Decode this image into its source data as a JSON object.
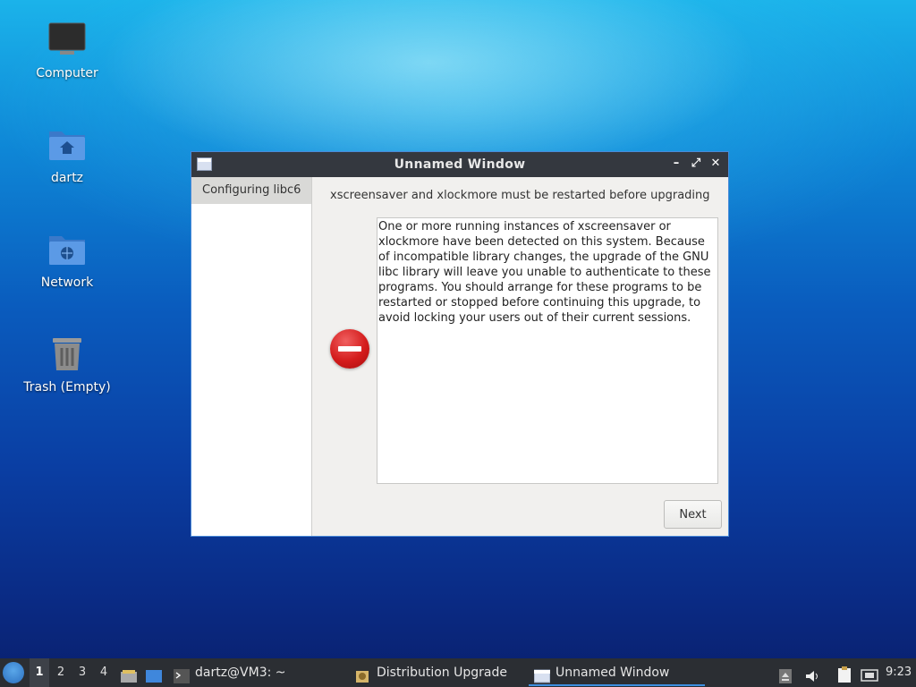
{
  "desktop": {
    "icons": [
      {
        "label": "Computer",
        "icon": "monitor-icon"
      },
      {
        "label": "dartz",
        "icon": "home-folder-icon"
      },
      {
        "label": "Network",
        "icon": "network-folder-icon"
      },
      {
        "label": "Trash (Empty)",
        "icon": "trash-icon"
      }
    ]
  },
  "window": {
    "title": "Unnamed Window",
    "controls": {
      "minimize": "–",
      "maximize": "⤢",
      "close": "✕"
    },
    "sidebar": {
      "steps": [
        "Configuring libc6"
      ]
    },
    "heading": "xscreensaver and xlockmore must be restarted before upgrading",
    "message": "One or more running instances of xscreensaver or xlockmore have been detected on this system. Because of incompatible library changes, the upgrade of the GNU libc library will leave you unable to authenticate to these programs. You should arrange for these programs to be restarted or stopped before continuing this upgrade, to avoid locking your users out of their current sessions.",
    "icon": "stop-icon",
    "next_label": "Next"
  },
  "taskbar": {
    "workspaces": [
      "1",
      "2",
      "3",
      "4"
    ],
    "active_workspace": "1",
    "tasks": [
      {
        "label": "dartz@VM3: ~",
        "icon": "terminal-icon"
      },
      {
        "label": "Distribution Upgrade",
        "icon": "upgrade-icon"
      },
      {
        "label": "Unnamed Window",
        "icon": "window-icon"
      }
    ],
    "clock": "9:23",
    "colors": {
      "accent": "#3d8fe0",
      "panel": "#2b2e33"
    }
  }
}
